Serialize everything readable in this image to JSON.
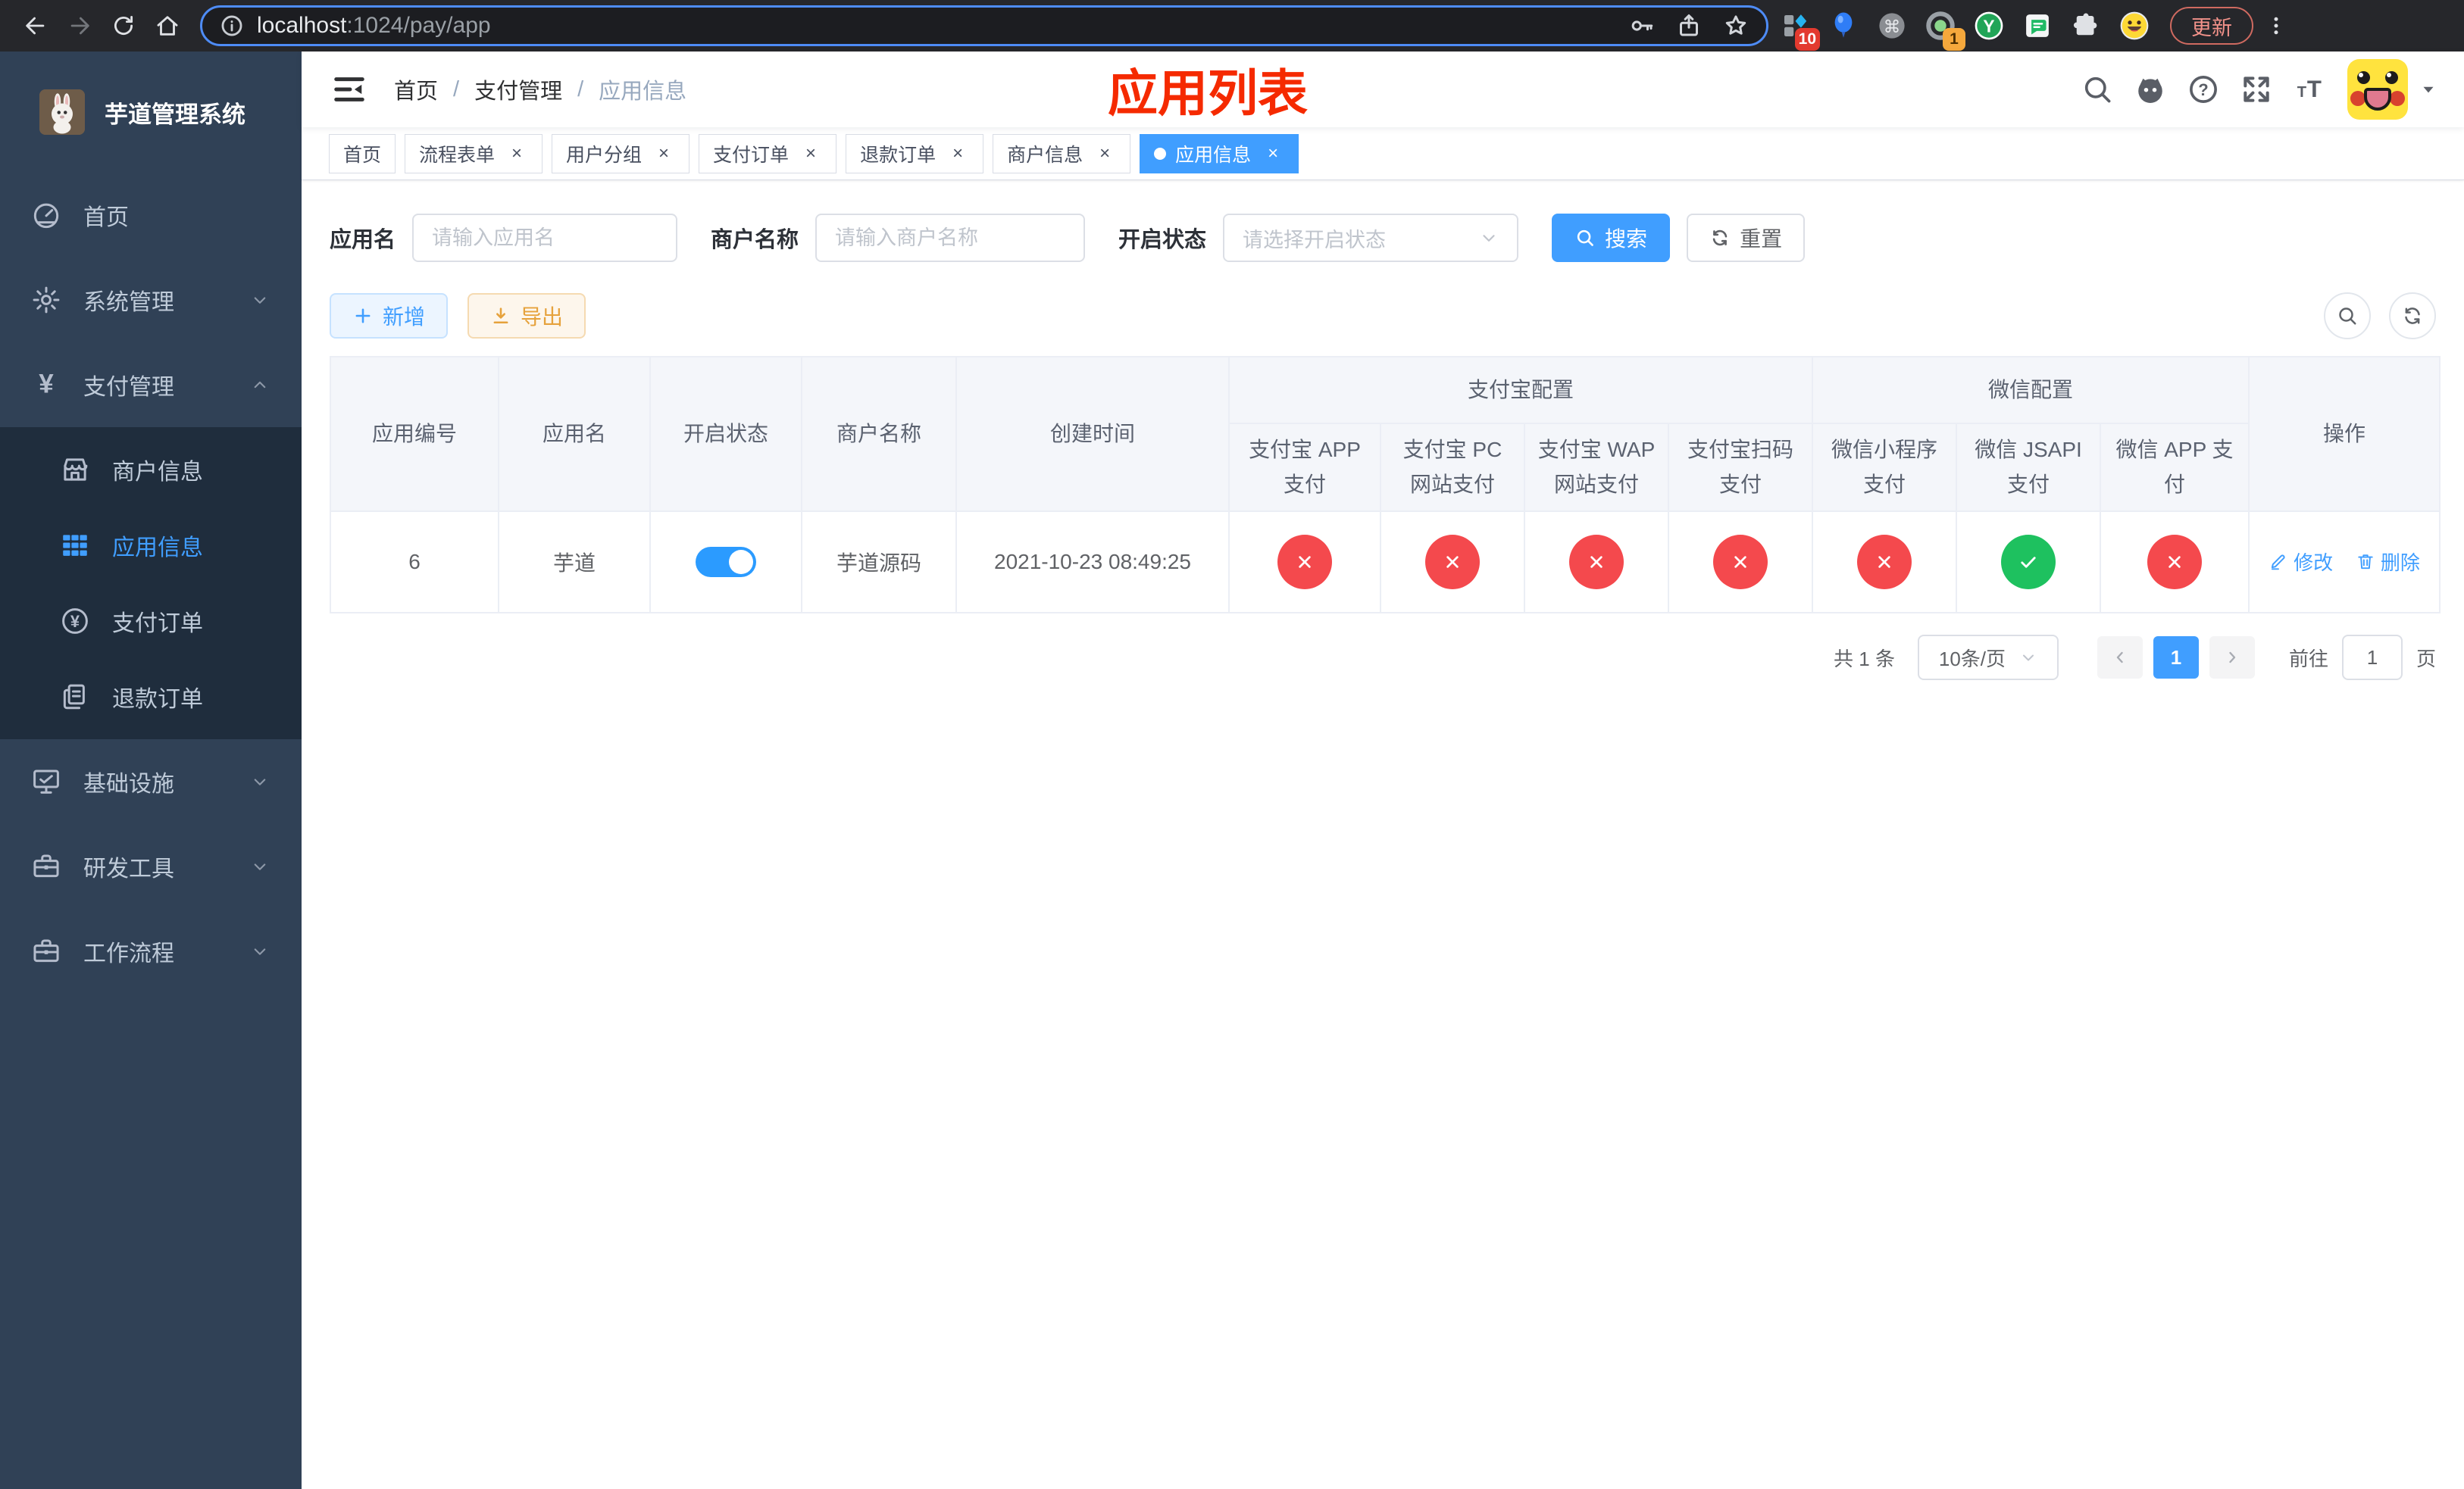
{
  "colors": {
    "primary": "#409eff",
    "danger": "#f4494d",
    "success": "#1ec15f",
    "warning": "#e6a23c",
    "annotation": "#f52a00",
    "sidebar_bg": "#304156",
    "submenu_bg": "#1f2d3d",
    "chrome_bg": "#26272b"
  },
  "browser": {
    "url_host": "localhost",
    "url_path": ":1024/pay/app",
    "update_label": "更新",
    "ext_badge_blocks": "10",
    "ext_badge_target": "1",
    "ext_y_letter": "Y"
  },
  "sidebar": {
    "title": "芋道管理系统",
    "menu": [
      {
        "key": "home",
        "label": "首页",
        "icon": "gauge-icon"
      },
      {
        "key": "system",
        "label": "系统管理",
        "icon": "gear-icon",
        "chevron": "down"
      },
      {
        "key": "payment",
        "label": "支付管理",
        "icon": "yuan-icon",
        "chevron": "up",
        "open": true,
        "children": [
          {
            "key": "merchant-info",
            "label": "商户信息",
            "icon": "store-icon"
          },
          {
            "key": "app-info",
            "label": "应用信息",
            "icon": "grid-icon",
            "active": true
          },
          {
            "key": "pay-order",
            "label": "支付订单",
            "icon": "yuan-circle-icon"
          },
          {
            "key": "refund-order",
            "label": "退款订单",
            "icon": "document-icon"
          }
        ]
      },
      {
        "key": "infrastructure",
        "label": "基础设施",
        "icon": "monitor-icon",
        "chevron": "down"
      },
      {
        "key": "devtools",
        "label": "研发工具",
        "icon": "toolbox-icon",
        "chevron": "down"
      },
      {
        "key": "workflow",
        "label": "工作流程",
        "icon": "toolbox-icon",
        "chevron": "down"
      }
    ]
  },
  "navbar": {
    "breadcrumb": [
      "首页",
      "支付管理",
      "应用信息"
    ],
    "annotation": "应用列表"
  },
  "tabs": [
    {
      "key": "home",
      "label": "首页",
      "closable": false,
      "active": false
    },
    {
      "key": "process-form",
      "label": "流程表单",
      "closable": true,
      "active": false
    },
    {
      "key": "user-group",
      "label": "用户分组",
      "closable": true,
      "active": false
    },
    {
      "key": "pay-order",
      "label": "支付订单",
      "closable": true,
      "active": false
    },
    {
      "key": "refund-order",
      "label": "退款订单",
      "closable": true,
      "active": false
    },
    {
      "key": "merchant-info",
      "label": "商户信息",
      "closable": true,
      "active": false
    },
    {
      "key": "app-info",
      "label": "应用信息",
      "closable": true,
      "active": true
    }
  ],
  "filters": {
    "app_name_label": "应用名",
    "app_name_placeholder": "请输入应用名",
    "merchant_label": "商户名称",
    "merchant_placeholder": "请输入商户名称",
    "status_label": "开启状态",
    "status_placeholder": "请选择开启状态",
    "search_label": "搜索",
    "reset_label": "重置"
  },
  "toolbar": {
    "add_label": "新增",
    "export_label": "导出"
  },
  "table": {
    "columns_simple": [
      "应用编号",
      "应用名",
      "开启状态",
      "商户名称",
      "创建时间"
    ],
    "column_groups": [
      {
        "label": "支付宝配置",
        "children": [
          "支付宝 APP 支付",
          "支付宝 PC 网站支付",
          "支付宝 WAP 网站支付",
          "支付宝扫码支付"
        ]
      },
      {
        "label": "微信配置",
        "children": [
          "微信小程序支付",
          "微信 JSAPI 支付",
          "微信 APP 支付"
        ]
      }
    ],
    "column_action": "操作",
    "rows": [
      {
        "id": "6",
        "name": "芋道",
        "enabled": true,
        "merchant": "芋道源码",
        "created_at": "2021-10-23 08:49:25",
        "channels": [
          false,
          false,
          false,
          false,
          false,
          true,
          false
        ],
        "edit_label": "修改",
        "delete_label": "删除"
      }
    ]
  },
  "pagination": {
    "total": "共 1 条",
    "page_size": "10条/页",
    "current_page": "1",
    "goto_label": "前往",
    "goto_value": "1",
    "unit_label": "页"
  }
}
